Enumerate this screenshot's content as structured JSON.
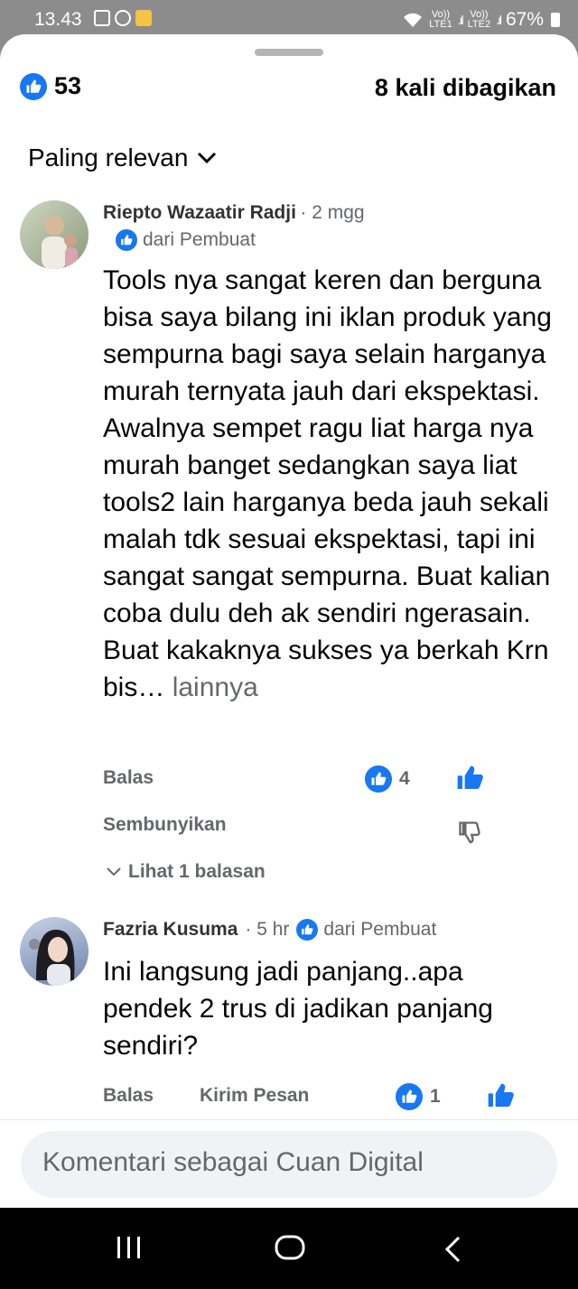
{
  "status_bar": {
    "time": "13.43",
    "battery": "67%",
    "sim1": "Vo))\nLTE1",
    "sim2": "Vo))\nLTE2"
  },
  "header": {
    "like_count": "53",
    "shares": "8 kali dibagikan",
    "sort_label": "Paling relevan"
  },
  "comments": [
    {
      "name": "Riepto Wazaatir Radji",
      "time": "· 2 mgg",
      "from_label": "dari Pembuat",
      "text": "Tools nya sangat keren dan berguna bisa saya bilang ini iklan produk yang sempurna bagi saya selain harganya murah ternyata jauh dari ekspektasi. Awalnya sempet ragu liat harga nya murah banget sedangkan saya liat tools2 lain harganya beda jauh sekali malah tdk sesuai ekspektasi, tapi ini sangat sangat sempurna. Buat kalian coba dulu deh ak sendiri ngerasain. Buat kakaknya sukses ya berkah Krn bis…",
      "more_label": "lainnya",
      "reply_label": "Balas",
      "like_count": "4",
      "hide_label": "Sembunyikan",
      "view_replies": "Lihat 1 balasan"
    },
    {
      "name": "Fazria Kusuma",
      "time": "· 5 hr",
      "from_label": "dari Pembuat",
      "text": "Ini langsung jadi panjang..apa pendek 2 trus di jadikan panjang sendiri?",
      "reply_label": "Balas",
      "message_label": "Kirim Pesan",
      "like_count": "1"
    }
  ],
  "composer": {
    "placeholder": "Komentari sebagai Cuan Digital"
  },
  "colors": {
    "accent": "#1877f2",
    "muted": "#65676b",
    "text": "#050505"
  }
}
